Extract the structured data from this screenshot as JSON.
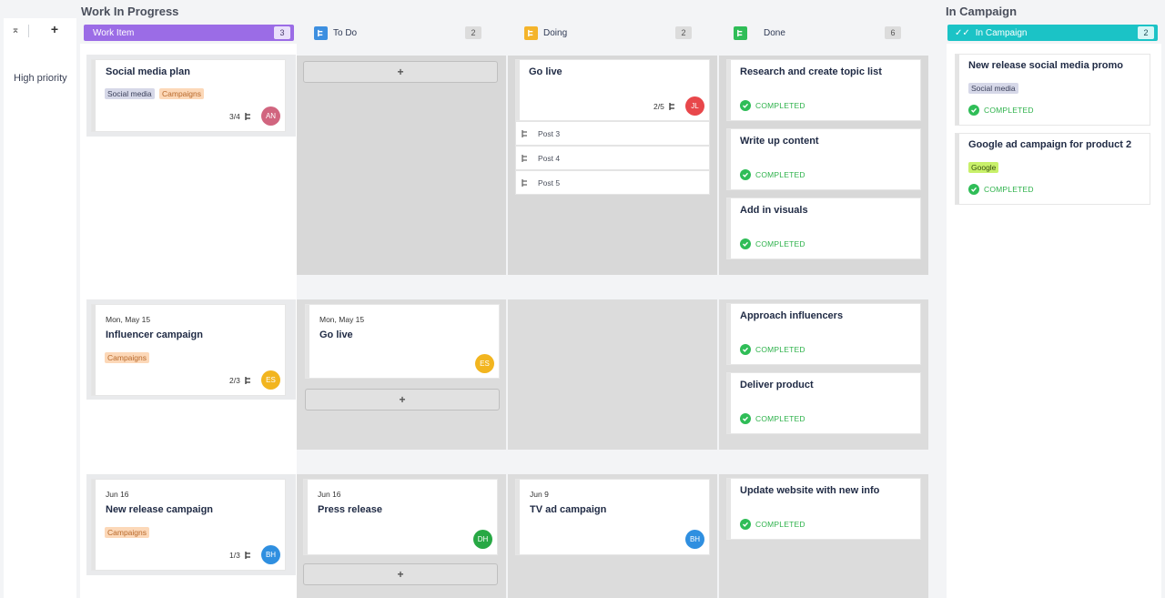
{
  "groups": {
    "wip_title": "Work In Progress",
    "campaign_title": "In Campaign"
  },
  "sidebar": {
    "collapse_icon": "⌅",
    "add_icon": "+",
    "lane1": "High priority"
  },
  "columns": {
    "work_item": {
      "label": "Work Item",
      "count": "3",
      "color": "#9b6ce6"
    },
    "todo": {
      "label": "To Do",
      "count": "2",
      "color": "#3d8fe0"
    },
    "doing": {
      "label": "Doing",
      "count": "2",
      "color": "#f4b42b"
    },
    "done": {
      "label": "Done",
      "count": "6",
      "color": "#2fbd57"
    },
    "in_campaign": {
      "label": "In Campaign",
      "count": "2",
      "color": "#1bc3c6"
    }
  },
  "add_label": "+",
  "completed_label": "COMPLETED",
  "cards": {
    "social_plan": {
      "title": "Social media plan",
      "tags": [
        "Social media",
        "Campaigns"
      ],
      "subtasks": "3/4",
      "avatar": "AN",
      "avatar_color": "#d1657f"
    },
    "go_live_1": {
      "title": "Go live",
      "subtasks": "2/5",
      "avatar": "JL",
      "avatar_color": "#e8474b",
      "children": [
        "Post 3",
        "Post 4",
        "Post 5"
      ]
    },
    "research": {
      "title": "Research and create topic list"
    },
    "write_up": {
      "title": "Write up content"
    },
    "visuals": {
      "title": "Add in visuals"
    },
    "influencer": {
      "date": "Mon, May 15",
      "title": "Influencer campaign",
      "tag": "Campaigns",
      "subtasks": "2/3",
      "avatar": "ES",
      "avatar_color": "#f2b51f"
    },
    "go_live_2": {
      "date": "Mon, May 15",
      "title": "Go live",
      "avatar": "ES",
      "avatar_color": "#f2b51f"
    },
    "approach": {
      "title": "Approach influencers"
    },
    "deliver": {
      "title": "Deliver product"
    },
    "new_release": {
      "date": "Jun 16",
      "title": "New release campaign",
      "tag": "Campaigns",
      "subtasks": "1/3",
      "avatar": "BH",
      "avatar_color": "#2f8fe0"
    },
    "press": {
      "date": "Jun 16",
      "title": "Press release",
      "avatar": "DH",
      "avatar_color": "#27a844"
    },
    "tv_ad": {
      "date": "Jun 9",
      "title": "TV ad campaign",
      "avatar": "BH",
      "avatar_color": "#2f8fe0"
    },
    "update_site": {
      "title": "Update website with new info"
    },
    "promo": {
      "title": "New release social media promo",
      "tag": "Social media"
    },
    "google_ad": {
      "title": "Google ad campaign for product 2",
      "tag": "Google"
    }
  }
}
